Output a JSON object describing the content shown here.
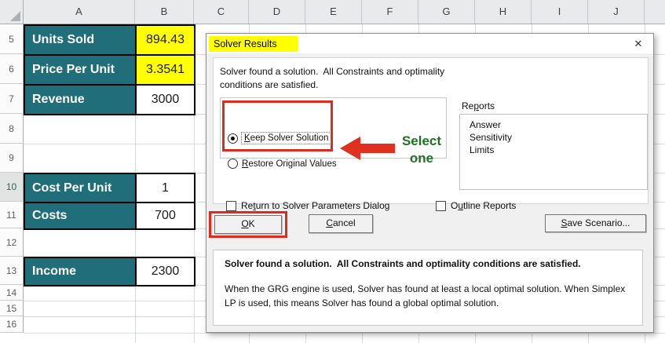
{
  "colors": {
    "teal": "#1F6E79",
    "yellow": "#FFFF00",
    "annotation_red": "#E0301F",
    "annotation_green": "#1E7125"
  },
  "spreadsheet": {
    "column_headers": [
      "A",
      "B",
      "C",
      "D",
      "E",
      "F",
      "G",
      "H",
      "I",
      "J"
    ],
    "rows": [
      {
        "num": "5",
        "label": "Units Sold",
        "value": "894.43"
      },
      {
        "num": "6",
        "label": "Price Per Unit",
        "value": "3.3541"
      },
      {
        "num": "7",
        "label": "Revenue",
        "value": "3000"
      },
      {
        "num": "8"
      },
      {
        "num": "9"
      },
      {
        "num": "10",
        "label": "Cost Per Unit",
        "value": "1"
      },
      {
        "num": "11",
        "label": "Costs",
        "value": "700"
      },
      {
        "num": "12"
      },
      {
        "num": "13",
        "label": "Income",
        "value": "2300"
      },
      {
        "num": "14"
      },
      {
        "num": "15"
      },
      {
        "num": "16"
      }
    ]
  },
  "dialog": {
    "title": "Solver Results",
    "close_glyph": "✕",
    "message": "Solver found a solution.  All Constraints and optimality\nconditions are satisfied.",
    "radio_keep": {
      "pre": "",
      "accel": "K",
      "post": "eep Solver Solution"
    },
    "radio_restore": {
      "pre": "",
      "accel": "R",
      "post": "estore Original Values"
    },
    "reports": {
      "label_pre": "Re",
      "label_accel": "p",
      "label_post": "orts",
      "items": [
        "Answer",
        "Sensitivity",
        "Limits"
      ]
    },
    "checkbox_return": {
      "pre": "Re",
      "accel": "t",
      "post": "urn to Solver Parameters Dialog"
    },
    "checkbox_outline": {
      "pre": "O",
      "accel": "u",
      "post": "tline Reports"
    },
    "ok": {
      "pre": "",
      "accel": "O",
      "post": "K"
    },
    "cancel": {
      "pre": "",
      "accel": "C",
      "post": "ancel"
    },
    "save_scenario": {
      "pre": "",
      "accel": "S",
      "post": "ave Scenario..."
    },
    "annotation": {
      "select_line1": "Select",
      "select_line2": "one"
    },
    "footer": {
      "bold": "Solver found a solution.  All Constraints and optimality conditions are satisfied.",
      "body": "When the GRG engine is used, Solver has found at least a local optimal solution. When Simplex LP is used, this means Solver has found a global optimal solution."
    }
  }
}
